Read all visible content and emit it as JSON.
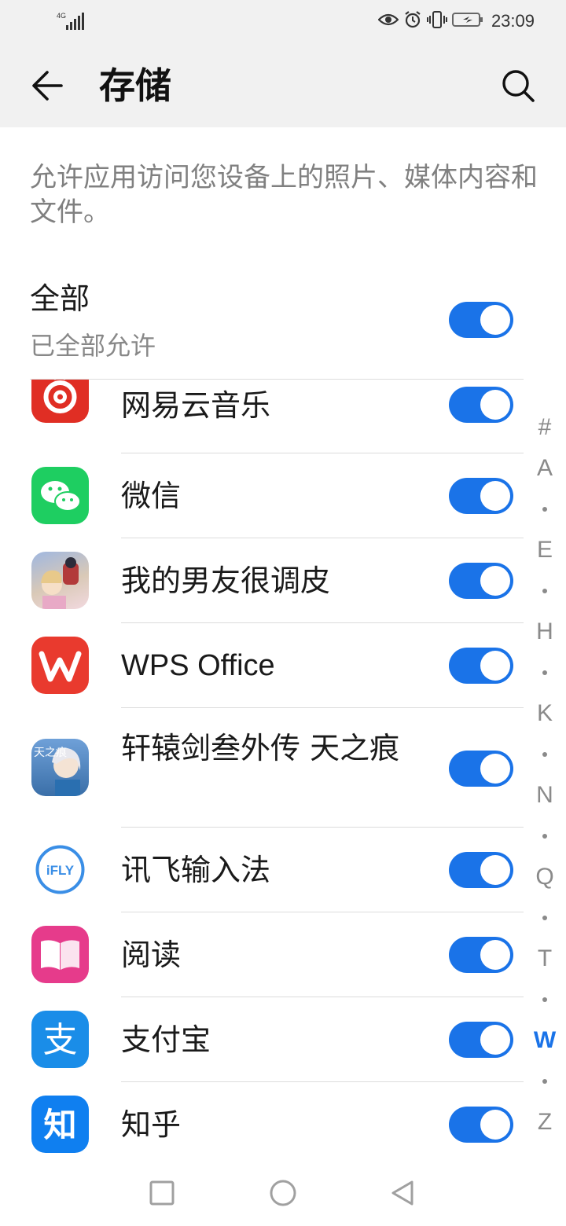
{
  "status_bar": {
    "network": "4G",
    "time": "23:09",
    "icons": [
      "signal-icon",
      "eye-icon",
      "alarm-icon",
      "vibrate-icon",
      "battery-charging-icon"
    ]
  },
  "header": {
    "title": "存储",
    "back_icon": "back-arrow-icon",
    "search_icon": "search-icon"
  },
  "description": "允许应用访问您设备上的照片、媒体内容和文件。",
  "all_toggle": {
    "label": "全部",
    "sublabel": "已全部允许",
    "enabled": true
  },
  "apps": [
    {
      "name": "网易云音乐",
      "icon": "netease-music-icon",
      "enabled": true,
      "color": "#e02e24"
    },
    {
      "name": "微信",
      "icon": "wechat-icon",
      "enabled": true,
      "color": "#1ece61"
    },
    {
      "name": "我的男友很调皮",
      "icon": "game-boyfriend-icon",
      "enabled": true,
      "color": "#7b9acc"
    },
    {
      "name": "WPS Office",
      "icon": "wps-office-icon",
      "enabled": true,
      "color": "#e93a2e"
    },
    {
      "name": "轩辕剑叁外传 天之痕",
      "icon": "xuanyuan-sword-icon",
      "enabled": true,
      "color": "#3a6fa8"
    },
    {
      "name": "讯飞输入法",
      "icon": "ifly-input-icon",
      "enabled": true,
      "color": "#3a8ee6"
    },
    {
      "name": "阅读",
      "icon": "reading-icon",
      "enabled": true,
      "color": "#e63b8b"
    },
    {
      "name": "支付宝",
      "icon": "alipay-icon",
      "enabled": true,
      "color": "#1a8de8"
    },
    {
      "name": "知乎",
      "icon": "zhihu-icon",
      "enabled": true,
      "color": "#0f7ff0"
    }
  ],
  "app_icon_text": {
    "ifly": "iFLY",
    "alipay": "支",
    "zhihu": "知",
    "xuanyuan": "天之痕"
  },
  "index_bar": {
    "items": [
      "#",
      "A",
      "•",
      "E",
      "•",
      "H",
      "•",
      "K",
      "•",
      "N",
      "•",
      "Q",
      "•",
      "T",
      "•",
      "W",
      "•",
      "Z"
    ],
    "active": "W"
  },
  "nav_bar": {
    "icons": [
      "recents-square-icon",
      "home-circle-icon",
      "back-triangle-icon"
    ]
  },
  "colors": {
    "accent": "#1a73e8",
    "header_bg": "#f1f1f1",
    "secondary_text": "#808080"
  }
}
